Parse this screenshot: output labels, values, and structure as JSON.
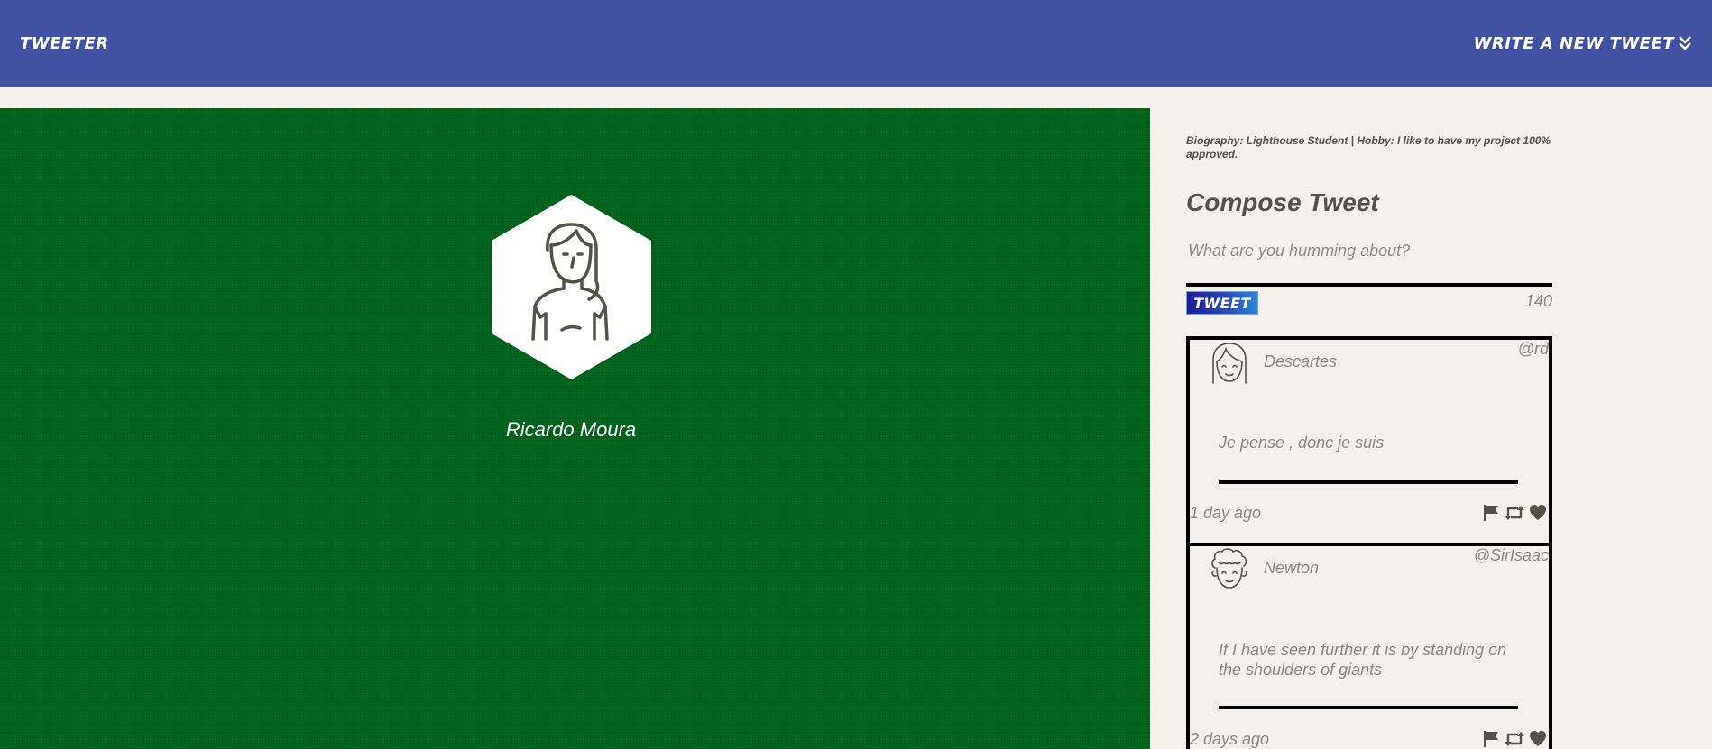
{
  "nav": {
    "brand": "TWEETER",
    "write_label": "WRITE A NEW TWEET",
    "background": "#4051a1"
  },
  "profile": {
    "name": "Ricardo Moura",
    "avatar_icon": "woman-avatar-icon",
    "background": "#006a1f"
  },
  "bio": {
    "text": "Biography: Lighthouse Student | Hobby: I like to have my project 100% approved."
  },
  "compose": {
    "title": "Compose Tweet",
    "placeholder": "What are you humming about?",
    "button_label": "TWEET",
    "counter": "140"
  },
  "tweets": [
    {
      "name": "Descartes",
      "handle": "@rd",
      "content": "Je pense , donc je suis",
      "date": "1 day ago",
      "avatar_icon": "girl-avatar-icon"
    },
    {
      "name": "Newton",
      "handle": "@SirIsaac",
      "content": "If I have seen further it is by standing on the shoulders of giants",
      "date": "2 days ago",
      "avatar_icon": "curly-hair-avatar-icon"
    }
  ],
  "actions": [
    "flag-icon",
    "retweet-icon",
    "heart-icon"
  ]
}
